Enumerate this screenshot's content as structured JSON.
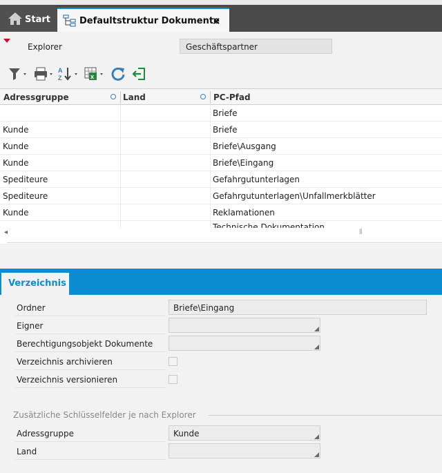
{
  "tabs": {
    "start_label": "Start",
    "doc_label": "Defaultstruktur Dokumente",
    "close_glyph": "✕"
  },
  "explorer": {
    "label": "Explorer",
    "value": "Geschäftspartner"
  },
  "toolbar": {
    "icons": [
      "filter-icon",
      "print-icon",
      "sort-icon",
      "excel-export-icon",
      "refresh-icon",
      "exit-icon"
    ]
  },
  "table": {
    "headers": [
      "Adressgruppe",
      "Land",
      "PC-Pfad"
    ],
    "rows": [
      {
        "adressgruppe": "",
        "land": "",
        "pfad": "Briefe"
      },
      {
        "adressgruppe": "Kunde",
        "land": "",
        "pfad": "Briefe"
      },
      {
        "adressgruppe": "Kunde",
        "land": "",
        "pfad": "Briefe\\Ausgang"
      },
      {
        "adressgruppe": "Kunde",
        "land": "",
        "pfad": "Briefe\\Eingang"
      },
      {
        "adressgruppe": "Spediteure",
        "land": "",
        "pfad": "Gefahrgutunterlagen"
      },
      {
        "adressgruppe": "Spediteure",
        "land": "",
        "pfad": "Gefahrgutunterlagen\\Unfallmerkblätter"
      },
      {
        "adressgruppe": "Kunde",
        "land": "",
        "pfad": "Reklamationen"
      },
      {
        "adressgruppe": "",
        "land": "",
        "pfad": "Technische Dokumentation"
      }
    ],
    "scroll_left_glyph": "◂",
    "scroll_thumb_glyph": "⦀"
  },
  "panel": {
    "tab_label": "Verzeichnis",
    "fields": {
      "ordner_label": "Ordner",
      "ordner_value": "Briefe\\Eingang",
      "eigner_label": "Eigner",
      "eigner_value": "",
      "berecht_label": "Berechtigungsobjekt Dokumente",
      "berecht_value": "",
      "archiv_label": "Verzeichnis archivieren",
      "archiv_checked": false,
      "version_label": "Verzeichnis versionieren",
      "version_checked": false
    },
    "group_title": "Zusätzliche Schlüsselfelder je nach Explorer",
    "group_fields": {
      "adress_label": "Adressgruppe",
      "adress_value": "Kunde",
      "land_label": "Land",
      "land_value": ""
    }
  },
  "colors": {
    "accent": "#0c8dd1",
    "tab_dark": "#4a4a4a",
    "marker": "#c8102e"
  }
}
